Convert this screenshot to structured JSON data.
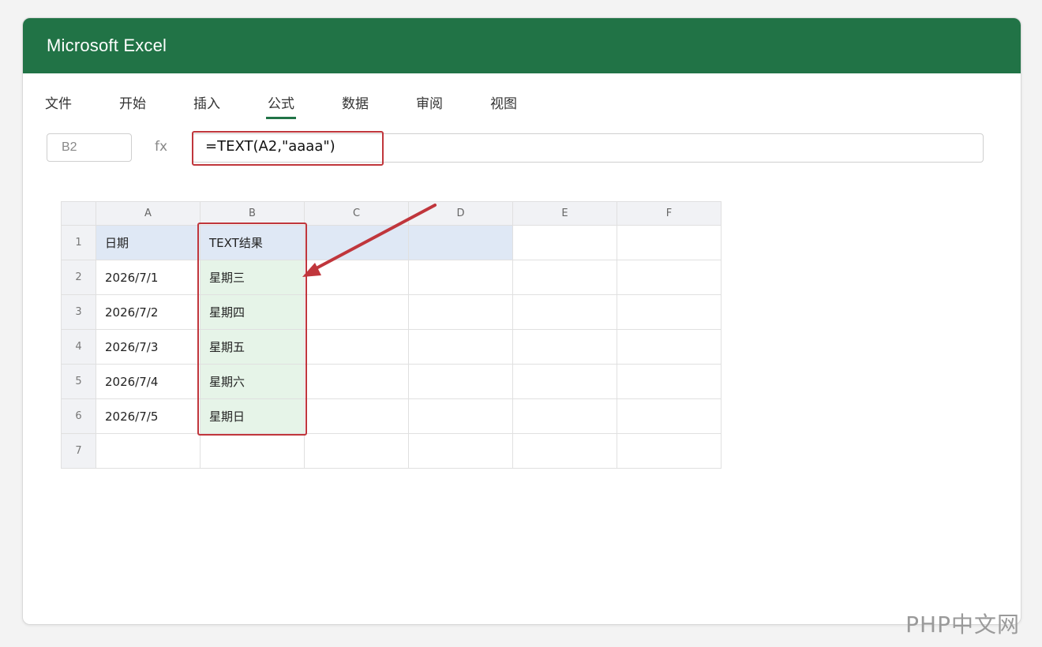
{
  "app": {
    "title": "Microsoft Excel",
    "accent_color": "#217346",
    "highlight_color": "#c0363c"
  },
  "ribbon": {
    "tabs": [
      {
        "label": "文件"
      },
      {
        "label": "开始"
      },
      {
        "label": "插入"
      },
      {
        "label": "公式",
        "active": true
      },
      {
        "label": "数据"
      },
      {
        "label": "审阅"
      },
      {
        "label": "视图"
      }
    ]
  },
  "formula_bar": {
    "name_box": "B2",
    "fx_label": "fx",
    "formula": "=TEXT(A2,\"aaaa\")"
  },
  "sheet": {
    "columns": [
      "A",
      "B",
      "C",
      "D",
      "E",
      "F"
    ],
    "rows": [
      {
        "num": "1",
        "cells": [
          "日期",
          "TEXT结果",
          "",
          "",
          "",
          ""
        ]
      },
      {
        "num": "2",
        "cells": [
          "2026/7/1",
          "星期三",
          "",
          "",
          "",
          ""
        ]
      },
      {
        "num": "3",
        "cells": [
          "2026/7/2",
          "星期四",
          "",
          "",
          "",
          ""
        ]
      },
      {
        "num": "4",
        "cells": [
          "2026/7/3",
          "星期五",
          "",
          "",
          "",
          ""
        ]
      },
      {
        "num": "5",
        "cells": [
          "2026/7/4",
          "星期六",
          "",
          "",
          "",
          ""
        ]
      },
      {
        "num": "6",
        "cells": [
          "2026/7/5",
          "星期日",
          "",
          "",
          "",
          ""
        ]
      },
      {
        "num": "7",
        "cells": [
          "",
          "",
          "",
          "",
          "",
          ""
        ]
      }
    ]
  },
  "watermark": "PHP中文网"
}
